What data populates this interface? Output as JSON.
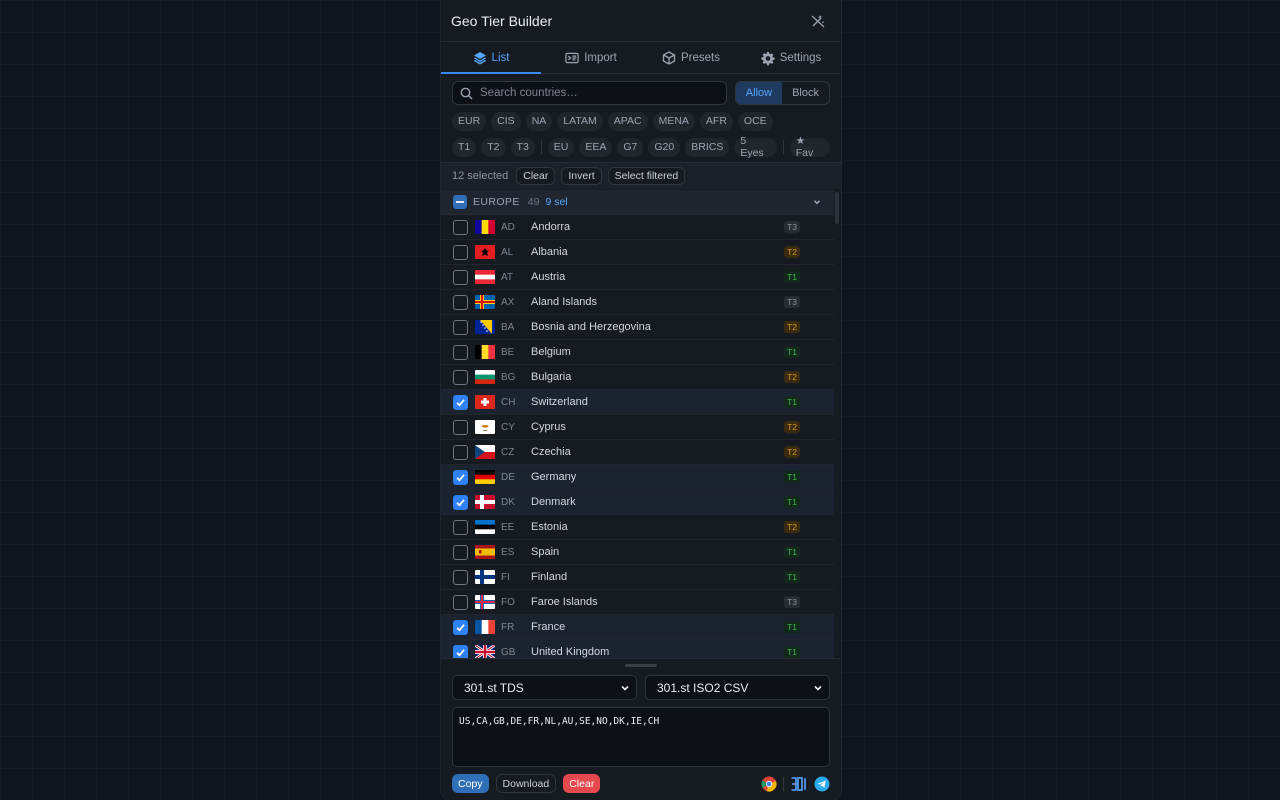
{
  "app": {
    "title": "Geo Tier Builder"
  },
  "tabs": [
    {
      "label": "List",
      "icon": "layers-icon",
      "active": true
    },
    {
      "label": "Import",
      "icon": "import-icon",
      "active": false
    },
    {
      "label": "Presets",
      "icon": "box-icon",
      "active": false
    },
    {
      "label": "Settings",
      "icon": "gear-icon",
      "active": false
    }
  ],
  "search": {
    "placeholder": "Search countries…",
    "value": ""
  },
  "mode": {
    "allow": "Allow",
    "block": "Block",
    "active": "allow"
  },
  "region_chips": [
    "EUR",
    "CIS",
    "NA",
    "LATAM",
    "APAC",
    "MENA",
    "AFR",
    "OCE"
  ],
  "tier_chips": [
    "T1",
    "T2",
    "T3"
  ],
  "bloc_chips": [
    "EU",
    "EEA",
    "G7",
    "G20",
    "BRICS",
    "5 Eyes"
  ],
  "fav_chip": "★ Fav",
  "selection": {
    "count_text": "12 selected",
    "clear": "Clear",
    "invert": "Invert",
    "select_filtered": "Select filtered"
  },
  "group": {
    "name": "EUROPE",
    "count": "49",
    "selected": "9 sel"
  },
  "countries": [
    {
      "iso": "AD",
      "name": "Andorra",
      "tier": "T3",
      "checked": false
    },
    {
      "iso": "AL",
      "name": "Albania",
      "tier": "T2",
      "checked": false
    },
    {
      "iso": "AT",
      "name": "Austria",
      "tier": "T1",
      "checked": false
    },
    {
      "iso": "AX",
      "name": "Aland Islands",
      "tier": "T3",
      "checked": false
    },
    {
      "iso": "BA",
      "name": "Bosnia and Herzegovina",
      "tier": "T2",
      "checked": false
    },
    {
      "iso": "BE",
      "name": "Belgium",
      "tier": "T1",
      "checked": false
    },
    {
      "iso": "BG",
      "name": "Bulgaria",
      "tier": "T2",
      "checked": false
    },
    {
      "iso": "CH",
      "name": "Switzerland",
      "tier": "T1",
      "checked": true
    },
    {
      "iso": "CY",
      "name": "Cyprus",
      "tier": "T2",
      "checked": false
    },
    {
      "iso": "CZ",
      "name": "Czechia",
      "tier": "T2",
      "checked": false
    },
    {
      "iso": "DE",
      "name": "Germany",
      "tier": "T1",
      "checked": true
    },
    {
      "iso": "DK",
      "name": "Denmark",
      "tier": "T1",
      "checked": true
    },
    {
      "iso": "EE",
      "name": "Estonia",
      "tier": "T2",
      "checked": false
    },
    {
      "iso": "ES",
      "name": "Spain",
      "tier": "T1",
      "checked": false
    },
    {
      "iso": "FI",
      "name": "Finland",
      "tier": "T1",
      "checked": false
    },
    {
      "iso": "FO",
      "name": "Faroe Islands",
      "tier": "T3",
      "checked": false
    },
    {
      "iso": "FR",
      "name": "France",
      "tier": "T1",
      "checked": true
    },
    {
      "iso": "GB",
      "name": "United Kingdom",
      "tier": "T1",
      "checked": true
    }
  ],
  "format": {
    "platform": "301.st TDS",
    "output_format": "301.st ISO2 CSV"
  },
  "output_text": "US,CA,GB,DE,FR,NL,AU,SE,NO,DK,IE,CH",
  "actions": {
    "copy": "Copy",
    "download": "Download",
    "clear": "Clear"
  },
  "footer_icons": [
    "chrome-icon",
    "brand-301-icon",
    "telegram-icon"
  ],
  "colors": {
    "accent": "#2f81f7",
    "tier1": "#3fb950",
    "tier2": "#d29922",
    "tier3": "#8b949e",
    "danger": "#e5484d"
  }
}
